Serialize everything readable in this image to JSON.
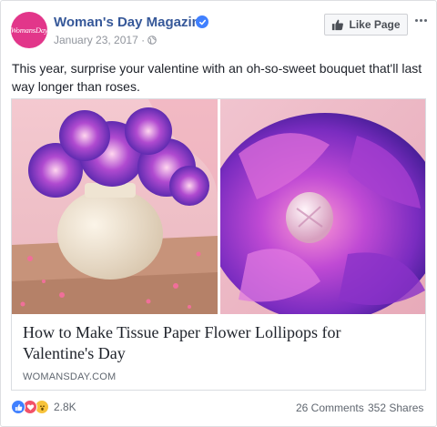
{
  "header": {
    "avatar_text": "WomansDay",
    "page_name": "Woman's Day Magazine",
    "date": "January 23, 2017 ·",
    "like_page_label": "Like Page"
  },
  "post": {
    "text": "This year, surprise your valentine with an oh-so-sweet bouquet that'll last way longer than roses."
  },
  "link": {
    "title": "How to Make Tissue Paper Flower Lollipops for Valentine's Day",
    "domain": "WOMANSDAY.COM"
  },
  "footer": {
    "reaction_count": "2.8K",
    "comments": "26 Comments",
    "shares": "352 Shares"
  },
  "colors": {
    "brand": "#365899",
    "avatar": "#e2368a",
    "like": "#4080ff",
    "love": "#f25268",
    "wow": "#f7c33b"
  },
  "icons": [
    "verified-badge-icon",
    "globe-icon",
    "thumbs-up-icon",
    "more-options-icon",
    "like-reaction-icon",
    "love-reaction-icon",
    "wow-reaction-icon"
  ]
}
